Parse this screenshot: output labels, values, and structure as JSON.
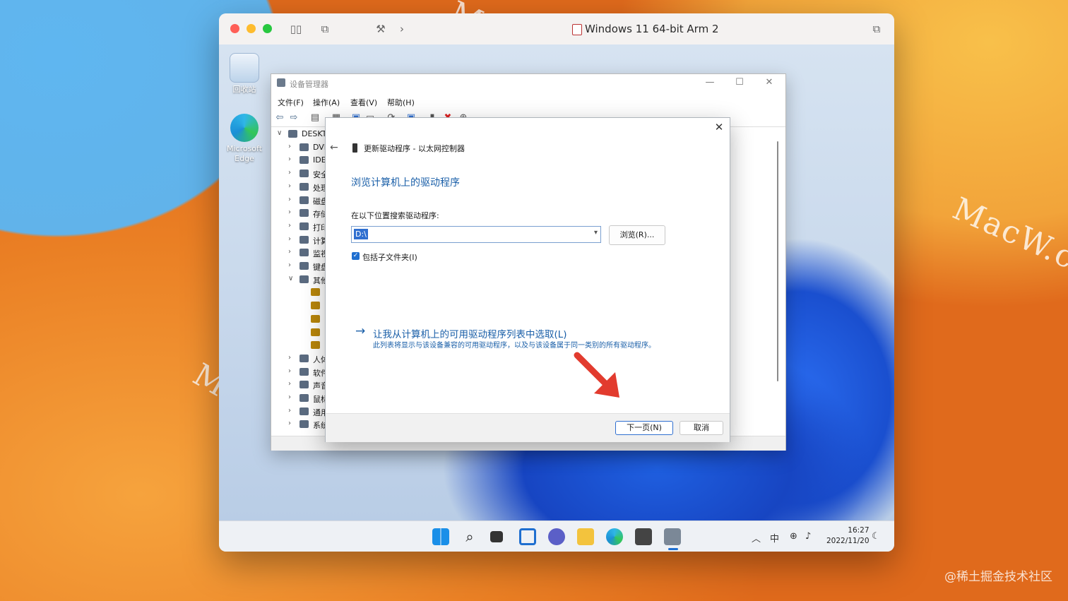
{
  "colors": {
    "accent_blue": "#1a5fa8",
    "selection_blue": "#2f6fd0",
    "red_arrow": "#e23b2e",
    "close_red": "#ff5f57",
    "minimize_yellow": "#febc2e",
    "maximize_green": "#28c840"
  },
  "mac": {
    "watermark": "MacW.com",
    "watermark_right": "MacW.c",
    "credit": "@稀土掘金技术社区"
  },
  "vm": {
    "title": "Windows 11 64-bit Arm 2"
  },
  "desktop": {
    "icons": [
      {
        "label": "回收站",
        "icon": "recycle-bin-icon"
      },
      {
        "label": "Microsoft Edge",
        "icon": "edge-icon"
      }
    ]
  },
  "devmgr": {
    "title": "设备管理器",
    "menu": [
      "文件(F)",
      "操作(A)",
      "查看(V)",
      "帮助(H)"
    ],
    "tree": [
      {
        "label": "DESKT",
        "chev": "∨"
      },
      {
        "label": "DVI",
        "chev": "›"
      },
      {
        "label": "IDE",
        "chev": "›"
      },
      {
        "label": "安全",
        "chev": "›"
      },
      {
        "label": "处理",
        "chev": "›"
      },
      {
        "label": "磁盘",
        "chev": "›"
      },
      {
        "label": "存储",
        "chev": "›"
      },
      {
        "label": "打印",
        "chev": "›"
      },
      {
        "label": "计算",
        "chev": "›"
      },
      {
        "label": "监视",
        "chev": "›"
      },
      {
        "label": "键盘",
        "chev": "›"
      },
      {
        "label": "其他",
        "chev": "∨"
      },
      {
        "label": "",
        "chev": ""
      },
      {
        "label": "",
        "chev": ""
      },
      {
        "label": "",
        "chev": ""
      },
      {
        "label": "",
        "chev": ""
      },
      {
        "label": "",
        "chev": ""
      },
      {
        "label": "人体",
        "chev": "›"
      },
      {
        "label": "软件",
        "chev": "›"
      },
      {
        "label": "声音",
        "chev": "›"
      },
      {
        "label": "鼠标",
        "chev": "›"
      },
      {
        "label": "通用",
        "chev": "›"
      },
      {
        "label": "系统",
        "chev": "›"
      }
    ]
  },
  "dialog": {
    "header": "更新驱动程序 - 以太网控制器",
    "heading": "浏览计算机上的驱动程序",
    "search_label": "在以下位置搜索驱动程序:",
    "path_value": "D:\\",
    "browse_label": "浏览(R)...",
    "include_subfolders": "包括子文件夹(I)",
    "pick_link": "让我从计算机上的可用驱动程序列表中选取(L)",
    "pick_desc": "此列表将显示与该设备兼容的可用驱动程序，以及与该设备属于同一类别的所有驱动程序。",
    "next_label": "下一页(N)",
    "cancel_label": "取消"
  },
  "taskbar": {
    "ime": "中",
    "time": "16:27",
    "date": "2022/11/20"
  }
}
